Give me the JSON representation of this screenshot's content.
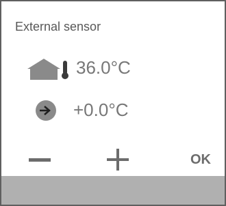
{
  "screen": {
    "title": "External sensor"
  },
  "readings": {
    "temperature": "36.0°C",
    "offset": "+0.0°C"
  },
  "icons": {
    "temperature": "home-thermometer-icon",
    "offset": "arrow-right-circle-icon"
  },
  "buttons": {
    "minus": "minus-button",
    "plus": "plus-button",
    "ok_label": "OK"
  },
  "colors": {
    "icon_gray": "#8a8a8a",
    "text_gray": "#777777",
    "button_gray": "#6c6c6c",
    "bottom_bar": "#b0b0b0",
    "border": "#5f5f5f"
  }
}
